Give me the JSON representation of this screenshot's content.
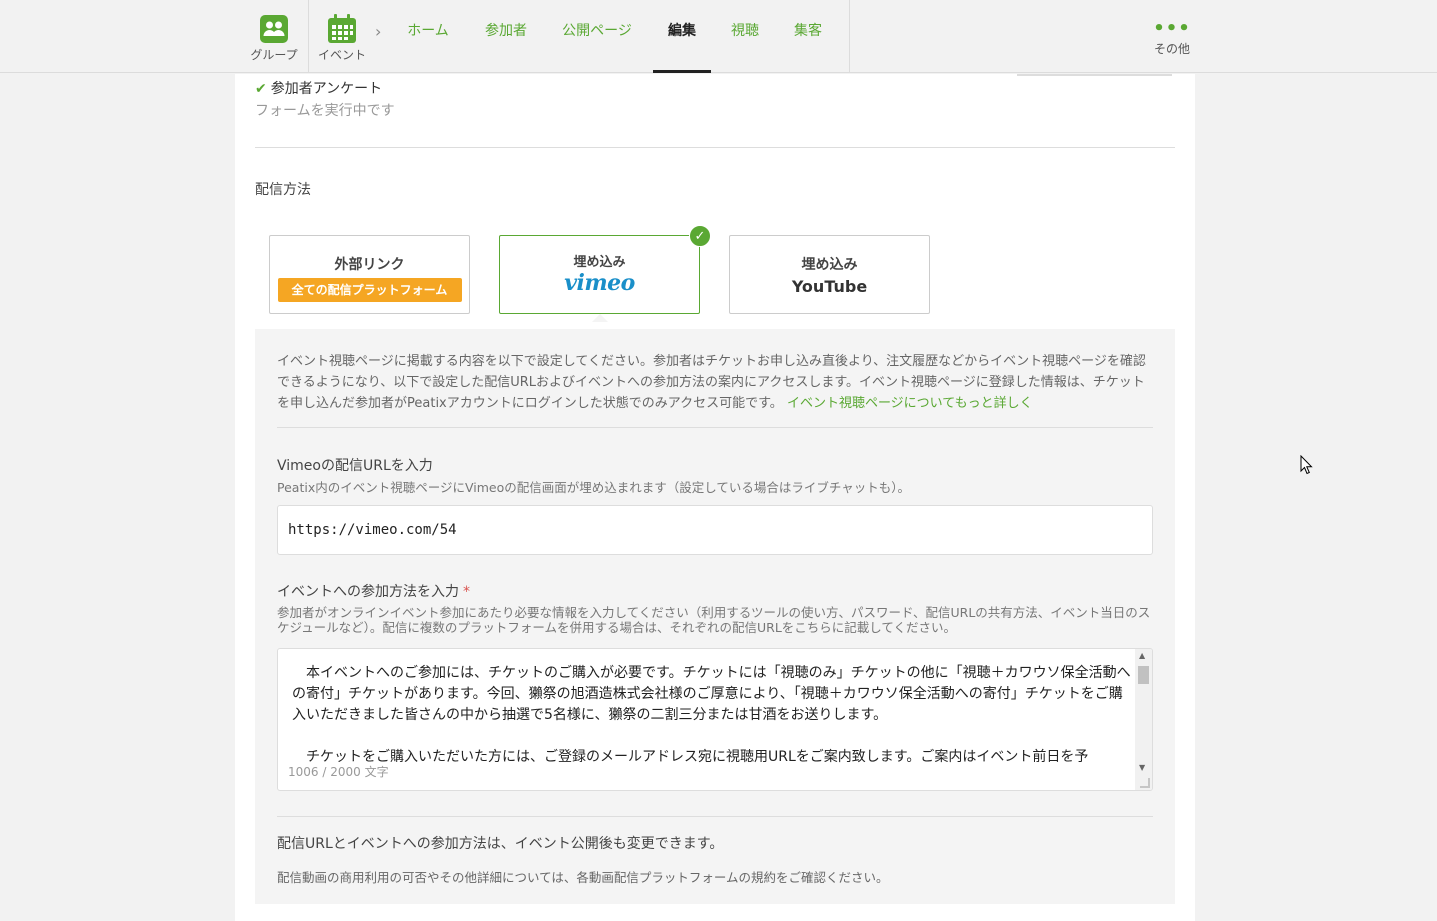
{
  "nav": {
    "group_label": "グループ",
    "event_label": "イベント",
    "tabs": [
      {
        "label": "ホーム"
      },
      {
        "label": "参加者"
      },
      {
        "label": "公開ページ"
      },
      {
        "label": "編集"
      },
      {
        "label": "視聴"
      },
      {
        "label": "集客"
      }
    ],
    "active_tab": "編集",
    "more_label": "その他"
  },
  "survey": {
    "title": "参加者アンケート",
    "status": "フォームを実行中です"
  },
  "delivery": {
    "section_label": "配信方法",
    "options": [
      {
        "title": "外部リンク",
        "badge": "全ての配信プラットフォーム"
      },
      {
        "title": "埋め込み",
        "brand": "vimeo",
        "selected": true
      },
      {
        "title": "埋め込み",
        "brand": "YouTube"
      }
    ]
  },
  "panel": {
    "intro": "イベント視聴ページに掲載する内容を以下で設定してください。参加者はチケットお申し込み直後より、注文履歴などからイベント視聴ページを確認できるようになり、以下で設定した配信URLおよびイベントへの参加方法の案内にアクセスします。イベント視聴ページに登録した情報は、チケットを申し込んだ参加者がPeatixアカウントにログインした状態でのみアクセス可能です。",
    "intro_link": "イベント視聴ページについてもっと詳しく",
    "url_label": "Vimeoの配信URLを入力",
    "url_help": "Peatix内のイベント視聴ページにVimeoの配信画面が埋め込まれます（設定している場合はライブチャットも）。",
    "url_value": "https://vimeo.com/54",
    "join_label": "イベントへの参加方法を入力",
    "join_required": "*",
    "join_help": "参加者がオンラインイベント参加にあたり必要な情報を入力してください（利用するツールの使い方、パスワード、配信URLの共有方法、イベント当日のスケジュールなど）。配信に複数のプラットフォームを併用する場合は、それぞれの配信URLをこちらに記載してください。",
    "join_paragraph_1": "本イベントへのご参加には、チケットのご購入が必要です。チケットには「視聴のみ」チケットの他に「視聴＋カワウソ保全活動への寄付」チケットがあります。今回、獺祭の旭酒造株式会社様のご厚意により、「視聴＋カワウソ保全活動への寄付」チケットをご購入いただきました皆さんの中から抽選で5名様に、獺祭の二割三分または甘酒をお送りします。",
    "join_paragraph_2": "チケットをご購入いただいた方には、ご登録のメールアドレス宛に視聴用URLをご案内致します。ご案内はイベント前日を予",
    "char_count": "1006 / 2000 文字",
    "note_1": "配信URLとイベントへの参加方法は、イベント公開後も変更できます。",
    "note_2": "配信動画の商用利用の可否やその他詳細については、各動画配信プラットフォームの規約をご確認ください。"
  },
  "colors": {
    "accent": "#5aa833",
    "badge": "#f5a623",
    "vimeo": "#1a8fc9"
  }
}
